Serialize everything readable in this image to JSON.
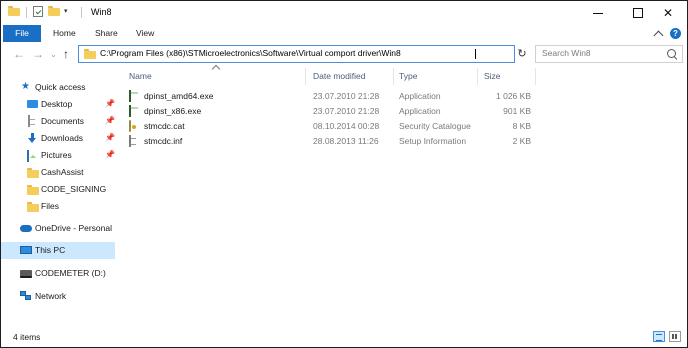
{
  "window": {
    "title": "Win8"
  },
  "ribbon": {
    "tabs": [
      {
        "label": "File"
      },
      {
        "label": "Home"
      },
      {
        "label": "Share"
      },
      {
        "label": "View"
      }
    ],
    "help_label": "?"
  },
  "address": {
    "path": "C:\\Program Files (x86)\\STMicroelectronics\\Software\\Virtual comport driver\\Win8"
  },
  "search": {
    "placeholder": "Search Win8"
  },
  "navigation": {
    "items": [
      {
        "label": "Quick access",
        "icon": "star-icon",
        "pinned": false
      },
      {
        "label": "Desktop",
        "icon": "desktop-icon",
        "pinned": true
      },
      {
        "label": "Documents",
        "icon": "documents-icon",
        "pinned": true
      },
      {
        "label": "Downloads",
        "icon": "downloads-icon",
        "pinned": true
      },
      {
        "label": "Pictures",
        "icon": "pictures-icon",
        "pinned": true
      },
      {
        "label": "CashAssist",
        "icon": "folder-icon",
        "pinned": false
      },
      {
        "label": "CODE_SIGNING",
        "icon": "folder-icon",
        "pinned": false
      },
      {
        "label": "Files",
        "icon": "folder-icon",
        "pinned": false
      },
      {
        "label": "OneDrive - Personal",
        "icon": "onedrive-icon",
        "pinned": false
      },
      {
        "label": "This PC",
        "icon": "this-pc-icon",
        "pinned": false,
        "selected": true
      },
      {
        "label": "CODEMETER (D:)",
        "icon": "drive-icon",
        "pinned": false
      },
      {
        "label": "Network",
        "icon": "network-icon",
        "pinned": false
      }
    ]
  },
  "files": {
    "columns": {
      "name": "Name",
      "date": "Date modified",
      "type": "Type",
      "size": "Size"
    },
    "rows": [
      {
        "name": "dpinst_amd64.exe",
        "date": "23.07.2010 21:28",
        "type": "Application",
        "size": "1 026 KB",
        "icon": "exe-icon"
      },
      {
        "name": "dpinst_x86.exe",
        "date": "23.07.2010 21:28",
        "type": "Application",
        "size": "901 KB",
        "icon": "exe-icon"
      },
      {
        "name": "stmcdc.cat",
        "date": "08.10.2014 00:28",
        "type": "Security Catalogue",
        "size": "8 KB",
        "icon": "catalog-icon"
      },
      {
        "name": "stmcdc.inf",
        "date": "28.08.2013 11:26",
        "type": "Setup Information",
        "size": "2 KB",
        "icon": "inf-icon"
      }
    ]
  },
  "status": {
    "item_count": "4 items"
  },
  "colors": {
    "accent": "#1a6fc4",
    "selection": "#cce8ff",
    "folder": "#f5cd5b",
    "header_text": "#4c607a"
  }
}
